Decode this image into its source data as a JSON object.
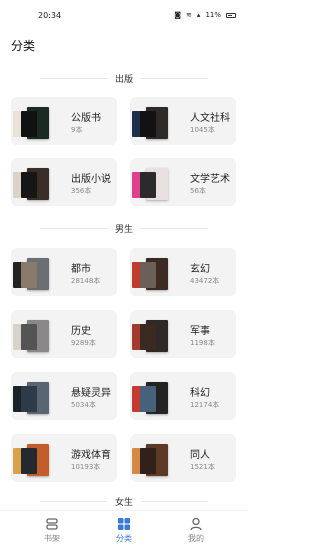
{
  "status_bar": {
    "time": "20:34",
    "battery": "11%"
  },
  "page": {
    "title": "分类"
  },
  "sections": [
    {
      "label": "出版"
    },
    {
      "label": "男生"
    },
    {
      "label": "女生"
    }
  ],
  "categories": {
    "publish": [
      {
        "name": "公版书",
        "count": "9本",
        "colors": [
          "#1b2a22",
          "#e7e3d6",
          "#111111"
        ]
      },
      {
        "name": "人文社科",
        "count": "1045本",
        "colors": [
          "#2d2a28",
          "#1d2f49",
          "#121212"
        ]
      },
      {
        "name": "出版小说",
        "count": "356本",
        "colors": [
          "#3a2f28",
          "#d9d4c7",
          "#161616"
        ]
      },
      {
        "name": "文学艺术",
        "count": "56本",
        "colors": [
          "#e7e2e0",
          "#e03f8a",
          "#2b2b2b"
        ]
      }
    ],
    "male": [
      {
        "name": "都市",
        "count": "28148本",
        "colors": [
          "#6b6e73",
          "#232323",
          "#8a7a6a"
        ]
      },
      {
        "name": "玄幻",
        "count": "43472本",
        "colors": [
          "#3b2b22",
          "#c23a2e",
          "#6a6058"
        ]
      },
      {
        "name": "历史",
        "count": "9289本",
        "colors": [
          "#8a8888",
          "#d7d2ca",
          "#545454"
        ]
      },
      {
        "name": "军事",
        "count": "1198本",
        "colors": [
          "#2f2a26",
          "#a4392e",
          "#3b2a20"
        ]
      },
      {
        "name": "悬疑灵异",
        "count": "5034本",
        "colors": [
          "#5a6573",
          "#1d2229",
          "#2c3b47"
        ]
      },
      {
        "name": "科幻",
        "count": "12174本",
        "colors": [
          "#232323",
          "#c63b31",
          "#46627a"
        ]
      },
      {
        "name": "游戏体育",
        "count": "10193本",
        "colors": [
          "#c45d2c",
          "#d9a24a",
          "#24292f"
        ]
      },
      {
        "name": "同人",
        "count": "1521本",
        "colors": [
          "#5e3a26",
          "#d38a45",
          "#31211a"
        ]
      }
    ]
  },
  "tabbar": {
    "items": [
      {
        "label": "书架",
        "icon": "bookshelf-icon",
        "active": false
      },
      {
        "label": "分类",
        "icon": "grid-icon",
        "active": true
      },
      {
        "label": "我的",
        "icon": "person-icon",
        "active": false
      }
    ],
    "accent": "#3a7bd5"
  }
}
